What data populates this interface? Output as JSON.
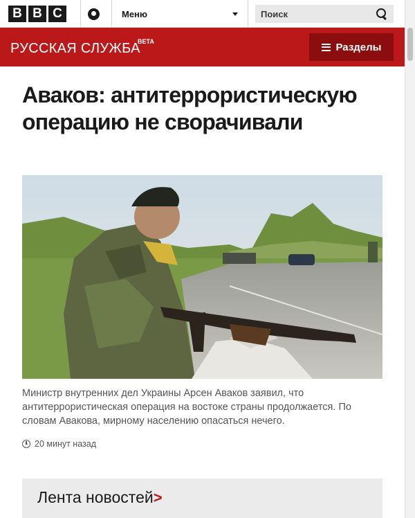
{
  "header": {
    "logo_letters": [
      "B",
      "B",
      "C"
    ],
    "menu_label": "Меню",
    "search_placeholder": "Поиск"
  },
  "service": {
    "title": "РУССКАЯ СЛУЖБА",
    "beta": "BETA",
    "sections_label": "Разделы",
    "brand_color": "#bb1919"
  },
  "article": {
    "headline": "Аваков: антитеррористическую операцию не сворачивали",
    "summary": "Министр внутренних дел Украины Арсен Аваков заявил, что антитеррористическая операция на востоке страны продолжается. По словам Авакова, мирному населению опасаться нечего.",
    "time": "20 минут назад"
  },
  "news_feed": {
    "label": "Лента новостей",
    "arrow": ">"
  },
  "icons": [
    "bbc-logo",
    "account-icon",
    "chevron-down-icon",
    "search-icon",
    "menu-icon",
    "clock-icon"
  ]
}
